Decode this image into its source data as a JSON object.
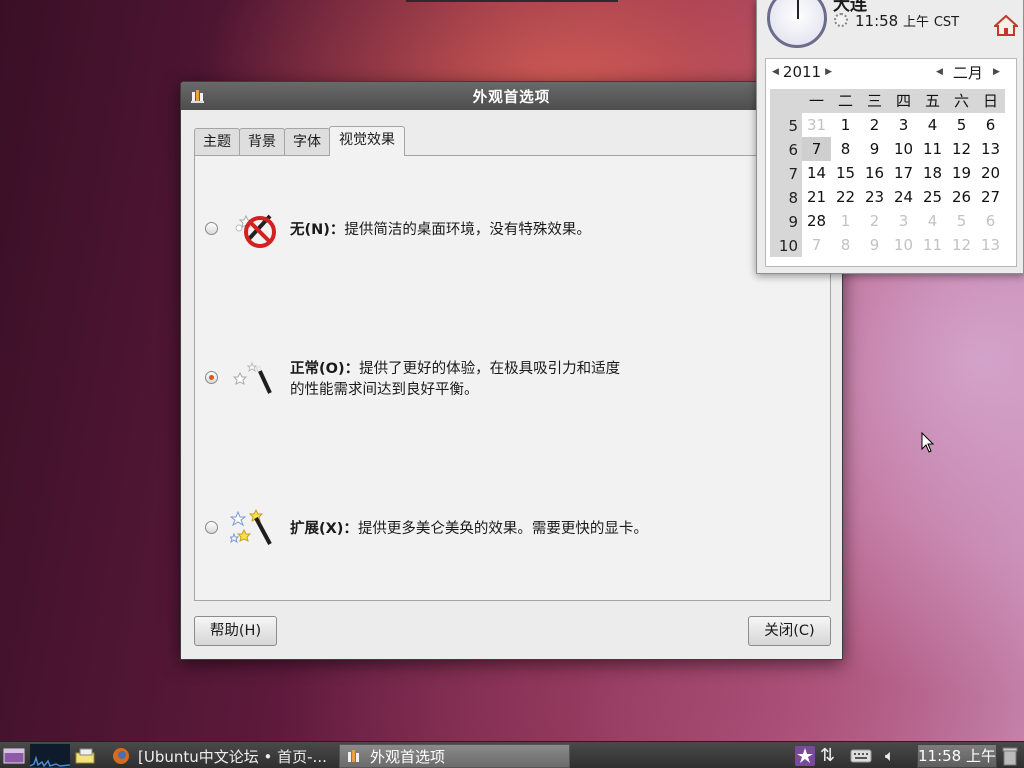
{
  "window": {
    "title": "外观首选项",
    "tabs": [
      {
        "label": "主题"
      },
      {
        "label": "背景"
      },
      {
        "label": "字体"
      },
      {
        "label": "视觉效果",
        "active": true
      }
    ],
    "options": [
      {
        "name": "无(N)：",
        "desc": "提供简洁的桌面环境，没有特殊效果。",
        "selected": false,
        "icon": "no-effects-icon"
      },
      {
        "name": "正常(O)：",
        "desc": "提供了更好的体验，在极具吸引力和适度",
        "desc2": "的性能需求间达到良好平衡。",
        "selected": true,
        "icon": "magic-wand-icon"
      },
      {
        "name": "扩展(X)：",
        "desc": "提供更多美仑美奂的效果。需要更快的显卡。",
        "selected": false,
        "icon": "sparkle-wand-icon"
      }
    ],
    "help_button": "帮助(H)",
    "close_button": "关闭(C)"
  },
  "calendar": {
    "city": "大连",
    "time": "11:58",
    "ampm": "上午",
    "tz": "CST",
    "year": "2011",
    "month": "二月",
    "weekdays": [
      "一",
      "二",
      "三",
      "四",
      "五",
      "六",
      "日"
    ],
    "weeks": [
      {
        "wk": "5",
        "days": [
          [
            "31",
            true
          ],
          [
            "1",
            false
          ],
          [
            "2",
            false
          ],
          [
            "3",
            false
          ],
          [
            "4",
            false
          ],
          [
            "5",
            false
          ],
          [
            "6",
            false
          ]
        ]
      },
      {
        "wk": "6",
        "days": [
          [
            "7",
            false
          ],
          [
            "8",
            false
          ],
          [
            "9",
            false
          ],
          [
            "10",
            false
          ],
          [
            "11",
            false
          ],
          [
            "12",
            false
          ],
          [
            "13",
            false
          ]
        ]
      },
      {
        "wk": "7",
        "days": [
          [
            "14",
            false
          ],
          [
            "15",
            false
          ],
          [
            "16",
            false
          ],
          [
            "17",
            false
          ],
          [
            "18",
            false
          ],
          [
            "19",
            false
          ],
          [
            "20",
            false
          ]
        ]
      },
      {
        "wk": "8",
        "days": [
          [
            "21",
            false
          ],
          [
            "22",
            false
          ],
          [
            "23",
            false
          ],
          [
            "24",
            false
          ],
          [
            "25",
            false
          ],
          [
            "26",
            false
          ],
          [
            "27",
            false
          ]
        ]
      },
      {
        "wk": "9",
        "days": [
          [
            "28",
            false
          ],
          [
            "1",
            true
          ],
          [
            "2",
            true
          ],
          [
            "3",
            true
          ],
          [
            "4",
            true
          ],
          [
            "5",
            true
          ],
          [
            "6",
            true
          ]
        ]
      },
      {
        "wk": "10",
        "days": [
          [
            "7",
            true
          ],
          [
            "8",
            true
          ],
          [
            "9",
            true
          ],
          [
            "10",
            true
          ],
          [
            "11",
            true
          ],
          [
            "12",
            true
          ],
          [
            "13",
            true
          ]
        ]
      }
    ],
    "today": "7"
  },
  "taskbar": {
    "tasks": [
      {
        "label": "[Ubuntu中文论坛 • 首页-...",
        "active": false
      },
      {
        "label": "外观首选项",
        "active": true
      }
    ],
    "clock": "11:58 上午"
  }
}
